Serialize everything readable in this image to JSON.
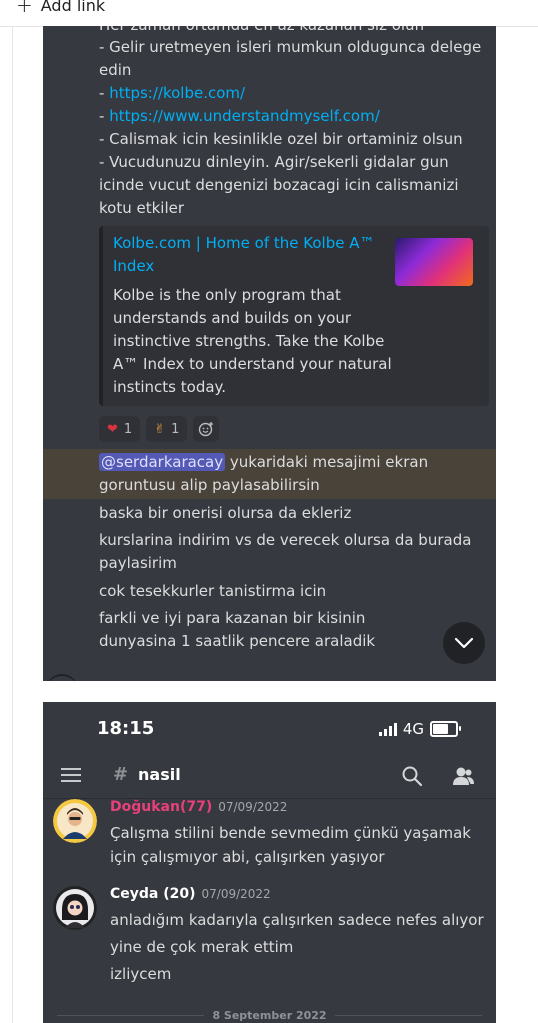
{
  "toolbar": {
    "add_link_icon": "plus-icon",
    "add_link_label": "Add link"
  },
  "screenshot1": {
    "cut_top_line": "Her zaman ortamda en az kazanan siz olun",
    "lines": [
      {
        "text": "- Gelir uretmeyen isleri mumkun oldugunca delege edin",
        "link": false
      },
      {
        "text": "- ",
        "link_text": "https://kolbe.com/",
        "link": true
      },
      {
        "text": "- ",
        "link_text": "https://www.understandmyself.com/",
        "link": true
      },
      {
        "text": "- Calismak icin kesinlikle ozel bir ortaminiz olsun",
        "link": false
      },
      {
        "text": "- Vucudunuzu dinleyin. Agir/sekerli gidalar gun icinde vucut dengenizi bozacagi icin calismanizi kotu etkiler",
        "link": false
      }
    ],
    "embed": {
      "title": "Kolbe.com | Home of the Kolbe A™ Index",
      "description": "Kolbe is the only program that understands and builds on your instinctive strengths. Take the Kolbe A™ Index to understand your natural instincts today."
    },
    "reactions": [
      {
        "emoji": "heart-emoji",
        "count": "1"
      },
      {
        "emoji": "rock-hand-emoji",
        "count": "1"
      }
    ],
    "mention": "@serdarkaracay",
    "mention_rest": " yukaridaki mesajimi ekran goruntusu alip paylasabilirsin",
    "messages": [
      "baska bir onerisi olursa da ekleriz",
      "kurslarina indirim vs de verecek olursa da burada paylasirim",
      "cok tesekkurler tanistirma icin",
      "farkli ve iyi para kazanan bir kisinin dunyasina 1 saatlik pencere araladik"
    ]
  },
  "screenshot2": {
    "time": "18:15",
    "network": "4G",
    "channel": "nasil",
    "posts": [
      {
        "author": "Doğukan(77)",
        "color": "#e8407a",
        "date": "07/09/2022",
        "lines": [
          "Çalışma stilini bende sevmedim çünkü yaşamak için çalışmıyor abi, çalışırken yaşıyor"
        ]
      },
      {
        "author": "Ceyda (20)",
        "color": "#ffffff",
        "date": "07/09/2022",
        "lines": [
          "anladığım kadarıyla çalışırken sadece nefes alıyor",
          "yine de çok merak ettim",
          "izliycem"
        ]
      }
    ],
    "date_divider": "8 September 2022"
  }
}
